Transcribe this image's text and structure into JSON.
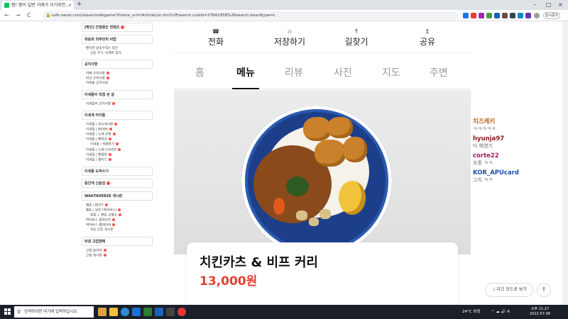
{
  "browser": {
    "tab_title": "짱! 짱이 일반 거래가 이거지만...",
    "tab_close": "×",
    "new_tab": "+",
    "window_controls": [
      "–",
      "□",
      "×"
    ],
    "nav": [
      "←",
      "→",
      "C"
    ],
    "url": "cafe.naver.com/steamindiegame?iframe_url=/ArticleList.nhn%3Fsearch.clubid=27842958%26search.boardtype=L",
    "pause_label": "일시중지",
    "accent": "#03c75a"
  },
  "sidebar": {
    "sections": [
      {
        "title": "[확인] 진행중인 컨텐츠",
        "items": []
      },
      {
        "title": "곽윤화 외부만의 비법",
        "items": [
          "팬치한 방송수익는 컵인",
          "상등 추기, 이벤트 참가"
        ]
      },
      {
        "title": "공지사항",
        "items": [
          "카페 공지사항",
          "마크 공지사항",
          "이세돌 공지사항"
        ]
      },
      {
        "title": "이세돌이 직접 쓴 글",
        "items": [
          "이세돌의 공지사항"
        ]
      },
      {
        "title": "이세계 아이돌",
        "items": [
          "이세돌 | 자유게시판",
          "이세돌 | NEWS",
          "이세돌 | 노래 균형",
          "이세돌 | 팬영상",
          "이세돌 | 직법후기",
          "이세돌 | 노래 COVER",
          "이세돌 | 팬클럽",
          "이세돌 | 롤이드"
        ]
      },
      {
        "title": "이세돌 도파수기",
        "items": []
      },
      {
        "title": "중간게 신슬검",
        "items": []
      },
      {
        "title": "WAKTAVERSE 게시판",
        "items": [
          "왬툰 | BEST",
          "왬툰 | 일반 (왁타버스)",
          "쌀롱 + 팬툰 유짱수",
          "왁타버스 클립모즈",
          "왁타버스 팰레이어",
          "적응 인증 게시판"
        ]
      },
      {
        "title": "버낸 고업멘에",
        "items": [
          "고힙 놀이터",
          "고힙 게시판"
        ]
      }
    ]
  },
  "main": {
    "actions": [
      {
        "icon": "phone-icon",
        "label": "전화"
      },
      {
        "icon": "star-icon",
        "label": "저장하기"
      },
      {
        "icon": "route-icon",
        "label": "길찾기"
      },
      {
        "icon": "share-icon",
        "label": "공유"
      }
    ],
    "tabs": [
      "홈",
      "메뉴",
      "리뷰",
      "사진",
      "지도",
      "주변"
    ],
    "active_tab": "메뉴",
    "menu_item": {
      "name": "치킨카츠 & 비프 커리",
      "price": "13,000원",
      "price_color": "#e2412d"
    }
  },
  "chat": [
    {
      "user": "치즈케키",
      "message": "ㅋㅋㅋㅋㅋ",
      "color": "#b5651d"
    },
    {
      "user": "hyunja97",
      "message": "다 헤였기",
      "color": "#8b1a1a"
    },
    {
      "user": "corte22",
      "message": "조종 ㅋㅋ",
      "color": "#a0205f"
    },
    {
      "user": "KOR_APUcard",
      "message": "그치 ㅋㅋ",
      "color": "#1d4fa8"
    }
  ],
  "floating": {
    "dark_mode": "다크 모드로 보기",
    "top": "↑"
  },
  "taskbar": {
    "search_placeholder": "검색하려면 여기에 입력하십시오.",
    "weather": "24°C 흐림",
    "time": "오후 11:27",
    "date": "2022-07-08"
  }
}
